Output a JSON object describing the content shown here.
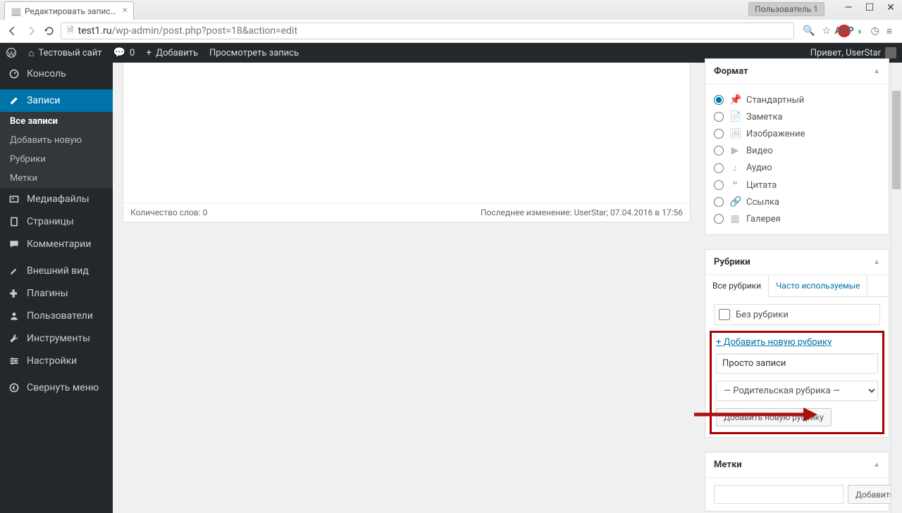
{
  "tab": {
    "title": "Редактировать запись ‹ Т"
  },
  "user_badge": "Пользователь 1",
  "url": {
    "host": "test1.ru",
    "path": "/wp-admin/post.php?post=18&action=edit"
  },
  "adminbar": {
    "site": "Тестовый сайт",
    "comments": "0",
    "add": "Добавить",
    "view": "Просмотреть запись",
    "greeting": "Привет, UserStar"
  },
  "sidebar": {
    "dashboard": "Консоль",
    "posts": "Записи",
    "posts_sub": {
      "all": "Все записи",
      "add": "Добавить новую",
      "categories": "Рубрики",
      "tags": "Метки"
    },
    "media": "Медиафайлы",
    "pages": "Страницы",
    "comments": "Комментарии",
    "appearance": "Внешний вид",
    "plugins": "Плагины",
    "users": "Пользователи",
    "tools": "Инструменты",
    "settings": "Настройки",
    "collapse": "Свернуть меню"
  },
  "editor": {
    "word_count": "Количество слов: 0",
    "last_edit": "Последнее изменение: UserStar; 07.04.2016 в 17:56"
  },
  "boxes": {
    "format": {
      "title": "Формат",
      "options": {
        "standard": "Стандартный",
        "aside": "Заметка",
        "image": "Изображение",
        "video": "Видео",
        "audio": "Аудио",
        "quote": "Цитата",
        "link": "Ссылка",
        "gallery": "Галерея"
      }
    },
    "categories": {
      "title": "Рубрики",
      "tab_all": "Все рубрики",
      "tab_popular": "Часто используемые",
      "uncategorized": "Без рубрики",
      "add_link": "+ Добавить новую рубрику",
      "new_cat_value": "Просто записи",
      "parent_label": "— Родительская рубрика —",
      "add_button": "Добавить новую рубрику"
    },
    "tags": {
      "title": "Метки",
      "add_button": "Добавить"
    }
  }
}
